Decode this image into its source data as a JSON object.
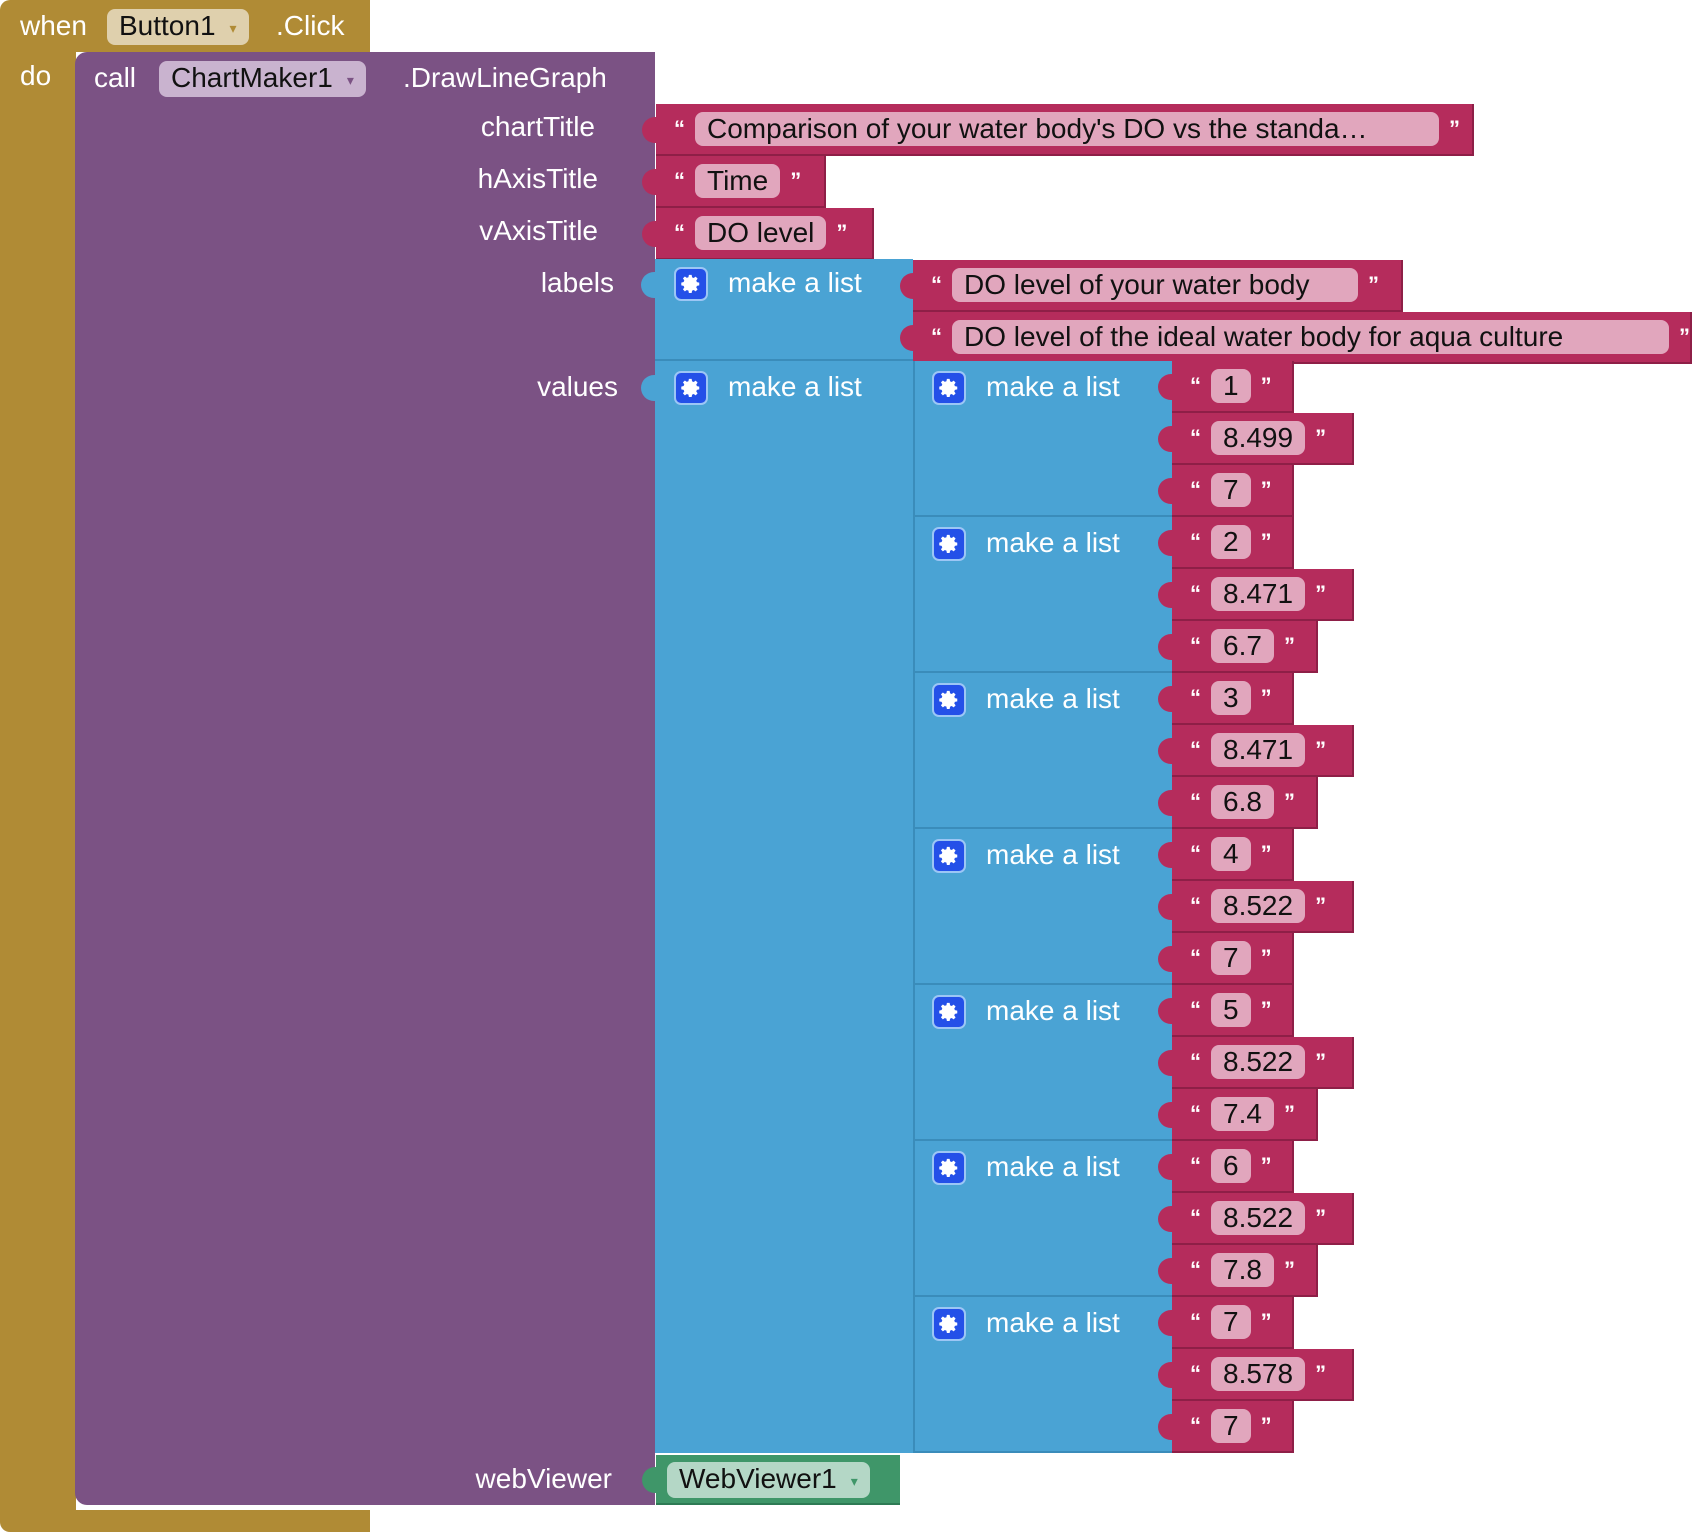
{
  "event": {
    "when_label": "when",
    "component": "Button1",
    "event_name": ".Click",
    "do_label": "do"
  },
  "call": {
    "call_label": "call",
    "component": "ChartMaker1",
    "method": ".DrawLineGraph"
  },
  "params": {
    "chartTitle": {
      "label": "chartTitle",
      "value": "Comparison of your water body's DO vs the standa…"
    },
    "hAxisTitle": {
      "label": "hAxisTitle",
      "value": "Time"
    },
    "vAxisTitle": {
      "label": "vAxisTitle",
      "value": "DO level"
    },
    "labels": {
      "label": "labels",
      "list_label": "make a list",
      "items": [
        "DO level of your water body",
        "DO level of the ideal water body for aqua culture"
      ]
    },
    "values": {
      "label": "values",
      "list_label": "make a list",
      "rows": [
        {
          "list_label": "make a list",
          "items": [
            "1",
            "8.499",
            "7"
          ]
        },
        {
          "list_label": "make a list",
          "items": [
            "2",
            "8.471",
            "6.7"
          ]
        },
        {
          "list_label": "make a list",
          "items": [
            "3",
            "8.471",
            "6.8"
          ]
        },
        {
          "list_label": "make a list",
          "items": [
            "4",
            "8.522",
            "7"
          ]
        },
        {
          "list_label": "make a list",
          "items": [
            "5",
            "8.522",
            "7.4"
          ]
        },
        {
          "list_label": "make a list",
          "items": [
            "6",
            "8.522",
            "7.8"
          ]
        },
        {
          "list_label": "make a list",
          "items": [
            "7",
            "8.578",
            "7"
          ]
        }
      ]
    },
    "webViewer": {
      "label": "webViewer",
      "component": "WebViewer1"
    }
  },
  "glyphs": {
    "open_quote": "“",
    "close_quote": "”",
    "dropdown": "▾"
  },
  "colors": {
    "event": "#b08b35",
    "procedure": "#7b5284",
    "list": "#4aa3d4",
    "text": "#b52c5c",
    "component": "#3f9669"
  }
}
